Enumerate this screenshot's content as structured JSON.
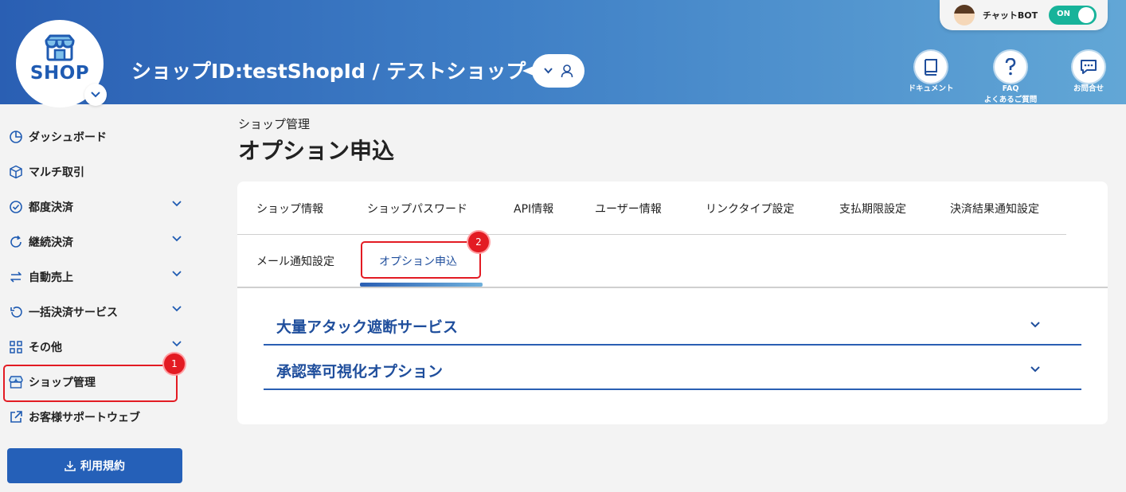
{
  "header": {
    "logo_text": "SHOP",
    "shop_title": "ショップID:testShopId / テストショップ",
    "chatbot": {
      "label": "チャットBOT",
      "toggle": "ON"
    },
    "buttons": [
      {
        "label": "ドキュメント",
        "icon": "book-icon"
      },
      {
        "label": "FAQ",
        "sublabel": "よくあるご質問",
        "icon": "question-icon"
      },
      {
        "label": "お問合せ",
        "icon": "chat-icon"
      }
    ]
  },
  "sidebar": {
    "items": [
      {
        "label": "ダッシュボード",
        "icon": "pie-chart-icon",
        "expandable": false
      },
      {
        "label": "マルチ取引",
        "icon": "cube-icon",
        "expandable": false
      },
      {
        "label": "都度決済",
        "icon": "check-circle-icon",
        "expandable": true
      },
      {
        "label": "継続決済",
        "icon": "refresh-icon",
        "expandable": true
      },
      {
        "label": "自動売上",
        "icon": "swap-icon",
        "expandable": true
      },
      {
        "label": "一括決済サービス",
        "icon": "undo-icon",
        "expandable": true
      },
      {
        "label": "その他",
        "icon": "grid-icon",
        "expandable": true
      },
      {
        "label": "ショップ管理",
        "icon": "shop-icon",
        "expandable": false
      },
      {
        "label": "お客様サポートウェブ",
        "icon": "external-link-icon",
        "expandable": false
      }
    ],
    "terms_button": "利用規約"
  },
  "annotations": {
    "badge1": "1",
    "badge2": "2"
  },
  "main": {
    "breadcrumb": "ショップ管理",
    "title": "オプション申込",
    "tabs_row1": [
      "ショップ情報",
      "ショップパスワード",
      "API情報",
      "ユーザー情報",
      "リンクタイプ設定",
      "支払期限設定",
      "決済結果通知設定"
    ],
    "tabs_row2": [
      "メール通知設定",
      "オプション申込"
    ],
    "active_tab": "オプション申込",
    "accordions": [
      "大量アタック遮断サービス",
      "承認率可視化オプション"
    ]
  },
  "colors": {
    "primary": "#2560b8",
    "accent_red": "#e31b23",
    "toggle_on": "#17b39a"
  }
}
